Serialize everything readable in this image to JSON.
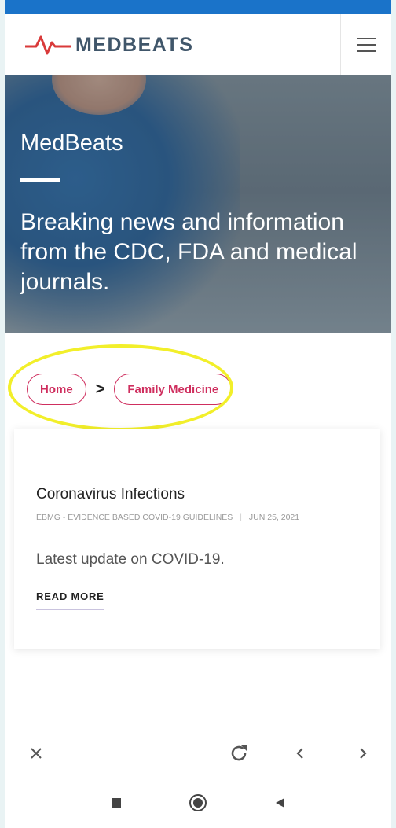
{
  "colors": {
    "accent": "#cf2e5e",
    "logo_text": "#40566a",
    "status_bar": "#1a73c9",
    "highlight": "#f2ef2a"
  },
  "header": {
    "logo_text": "MEDBEATS",
    "menu_icon": "hamburger-icon"
  },
  "hero": {
    "title": "MedBeats",
    "subtitle": "Breaking news and information from the CDC, FDA and medical journals."
  },
  "breadcrumb": {
    "items": [
      {
        "label": "Home"
      },
      {
        "label": "Family Medicine"
      }
    ],
    "separator": ">"
  },
  "article": {
    "title": "Coronavirus Infections",
    "source": "EBMG - EVIDENCE BASED COVID-19 GUIDELINES",
    "meta_separator": "|",
    "date": "JUN 25, 2021",
    "summary": "Latest update on COVID-19.",
    "cta": "READ MORE"
  },
  "browser_toolbar": {
    "icons": [
      "close-icon",
      "reload-icon",
      "back-arrow-icon",
      "forward-arrow-icon"
    ]
  },
  "system_nav": {
    "icons": [
      "recents-icon",
      "home-icon",
      "back-icon"
    ]
  }
}
